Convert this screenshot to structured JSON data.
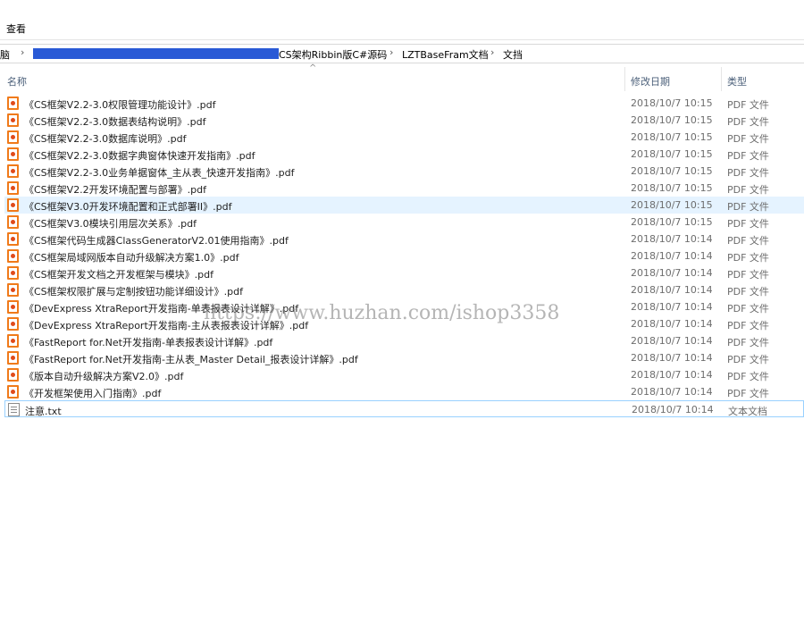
{
  "menubar": {
    "view_label": "查看"
  },
  "breadcrumb": {
    "partial_root": "脑",
    "items": [
      "CS架构Ribbin版C#源码",
      "LZTBaseFram文档",
      "文挡"
    ]
  },
  "columns": {
    "name": "名称",
    "modified": "修改日期",
    "type": "类型"
  },
  "files": [
    {
      "name": "《CS框架V2.2-3.0权限管理功能设计》.pdf",
      "date": "2018/10/7 10:15",
      "type": "PDF 文件",
      "icon": "pdf-icon"
    },
    {
      "name": "《CS框架V2.2-3.0数据表结构说明》.pdf",
      "date": "2018/10/7 10:15",
      "type": "PDF 文件",
      "icon": "pdf-icon"
    },
    {
      "name": "《CS框架V2.2-3.0数据库说明》.pdf",
      "date": "2018/10/7 10:15",
      "type": "PDF 文件",
      "icon": "pdf-icon"
    },
    {
      "name": "《CS框架V2.2-3.0数据字典窗体快速开发指南》.pdf",
      "date": "2018/10/7 10:15",
      "type": "PDF 文件",
      "icon": "pdf-icon"
    },
    {
      "name": "《CS框架V2.2-3.0业务单据窗体_主从表_快速开发指南》.pdf",
      "date": "2018/10/7 10:15",
      "type": "PDF 文件",
      "icon": "pdf-icon"
    },
    {
      "name": "《CS框架V2.2开发环境配置与部署》.pdf",
      "date": "2018/10/7 10:15",
      "type": "PDF 文件",
      "icon": "pdf-icon"
    },
    {
      "name": "《CS框架V3.0开发环境配置和正式部署II》.pdf",
      "date": "2018/10/7 10:15",
      "type": "PDF 文件",
      "icon": "pdf-icon"
    },
    {
      "name": "《CS框架V3.0模块引用层次关系》.pdf",
      "date": "2018/10/7 10:15",
      "type": "PDF 文件",
      "icon": "pdf-icon"
    },
    {
      "name": "《CS框架代码生成器ClassGeneratorV2.01使用指南》.pdf",
      "date": "2018/10/7 10:14",
      "type": "PDF 文件",
      "icon": "pdf-icon"
    },
    {
      "name": "《CS框架局域网版本自动升级解决方案1.0》.pdf",
      "date": "2018/10/7 10:14",
      "type": "PDF 文件",
      "icon": "pdf-icon"
    },
    {
      "name": "《CS框架开发文档之开发框架与模块》.pdf",
      "date": "2018/10/7 10:14",
      "type": "PDF 文件",
      "icon": "pdf-icon"
    },
    {
      "name": "《CS框架权限扩展与定制按钮功能详细设计》.pdf",
      "date": "2018/10/7 10:14",
      "type": "PDF 文件",
      "icon": "pdf-icon"
    },
    {
      "name": "《DevExpress XtraReport开发指南-单表报表设计详解》.pdf",
      "date": "2018/10/7 10:14",
      "type": "PDF 文件",
      "icon": "pdf-icon"
    },
    {
      "name": "《DevExpress XtraReport开发指南-主从表报表设计详解》.pdf",
      "date": "2018/10/7 10:14",
      "type": "PDF 文件",
      "icon": "pdf-icon"
    },
    {
      "name": "《FastReport for.Net开发指南-单表报表设计详解》.pdf",
      "date": "2018/10/7 10:14",
      "type": "PDF 文件",
      "icon": "pdf-icon"
    },
    {
      "name": "《FastReport for.Net开发指南-主从表_Master Detail_报表设计详解》.pdf",
      "date": "2018/10/7 10:14",
      "type": "PDF 文件",
      "icon": "pdf-icon"
    },
    {
      "name": "《版本自动升级解决方案V2.0》.pdf",
      "date": "2018/10/7 10:14",
      "type": "PDF 文件",
      "icon": "pdf-icon"
    },
    {
      "name": "《开发框架使用入门指南》.pdf",
      "date": "2018/10/7 10:14",
      "type": "PDF 文件",
      "icon": "pdf-icon"
    },
    {
      "name": "注意.txt",
      "date": "2018/10/7 10:14",
      "type": "文本文档",
      "icon": "txt-icon"
    }
  ],
  "watermark": "https://www.huzhan.com/ishop3358"
}
